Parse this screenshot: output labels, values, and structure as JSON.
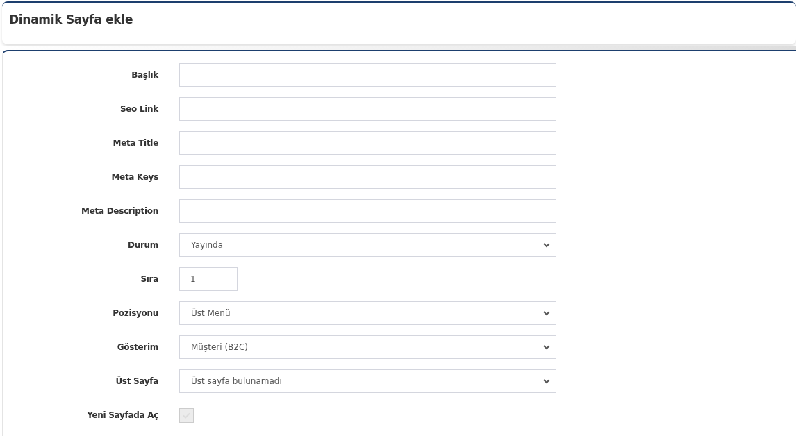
{
  "header": {
    "title": "Dinamik Sayfa ekle"
  },
  "form": {
    "fields": [
      {
        "kind": "text",
        "label": "Başlık"
      },
      {
        "kind": "text",
        "label": "Seo Link"
      },
      {
        "kind": "text",
        "label": "Meta Title"
      },
      {
        "kind": "text",
        "label": "Meta Keys"
      },
      {
        "kind": "text",
        "label": "Meta Description"
      },
      {
        "kind": "select",
        "label": "Durum",
        "value": "Yayında"
      },
      {
        "kind": "number",
        "label": "Sıra",
        "value": "1"
      },
      {
        "kind": "select",
        "label": "Pozisyonu",
        "value": "Üst Menü"
      },
      {
        "kind": "select",
        "label": "Gösterim",
        "value": "Müşteri (B2C)"
      },
      {
        "kind": "select",
        "label": "Üst Sayfa",
        "value": "Üst sayfa bulunamadı"
      },
      {
        "kind": "checkbox",
        "label": "Yeni Sayfada Aç",
        "checked": true,
        "disabled": true
      }
    ]
  }
}
